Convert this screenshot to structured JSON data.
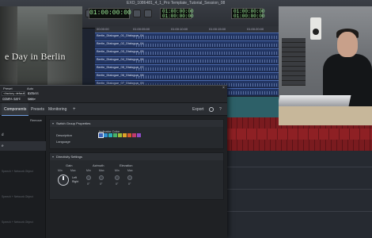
{
  "daw": {
    "window_title": "EXO_1086481_4_1_Pro Template_Tutorial_Session_08",
    "main_counter": "01:00:00:00",
    "sub_counter_a": [
      "01:00:00:00",
      "01:00:00:00",
      "00:00:00:00"
    ],
    "sub_counter_b": [
      "01:00:00:00",
      "01:00:00:00",
      "00:00:00:00"
    ],
    "ruler_marks": [
      "00:00:00",
      "01:00:05:00",
      "01:00:10:00",
      "01:00:15:00",
      "01:00:20:00"
    ],
    "clips": [
      "Berlin_Dialogue_01_Dialogue_04",
      "Berlin_Dialogue_02_Dialogue_04",
      "Berlin_Dialogue_03_Dialogue_05",
      "Berlin_Dialogue_04_Dialogue_06",
      "Berlin_Dialogue_05_Dialogue_07",
      "Berlin_Dialogue_06_Dialogue_08",
      "Berlin_Dialogue_07_Dialogue_09",
      "Berlin_Dialogue_08_Dialogue_10"
    ]
  },
  "video": {
    "caption": "e Day in Berlin"
  },
  "dialog": {
    "preset_label": "Preset",
    "preset_value": "<factory default>",
    "auto_label": "Auto",
    "bypass_label": "BYPASS",
    "compare_label": "COMPARE",
    "safe_label": "SAFE",
    "native_label": "Native",
    "close": "×",
    "tabs": [
      "Components",
      "Presets",
      "Monitoring"
    ],
    "active_tab": "Components",
    "add_tab": "+",
    "export_label": "Export",
    "help": "?",
    "sidebar": {
      "remove_label": "Remove",
      "items": [
        "d",
        "e",
        "Speech + Network Object",
        "Speech + Network Object",
        "Speech + Network Object"
      ]
    },
    "switch_group": {
      "title": "Switch Group Properties",
      "description_label": "Description",
      "language_label": "Language",
      "indicator_label": "Indicator Color",
      "colors": [
        "#3b63b7",
        "#2f8fd1",
        "#2cb0b8",
        "#46b26a",
        "#9cbf3a",
        "#e0a329",
        "#d65a2b",
        "#c23a6d",
        "#8e4bc4"
      ]
    },
    "directivity": {
      "title": "Directivity Settings",
      "gain_label": "Gain",
      "azimuth_label": "Azimuth",
      "elevation_label": "Elevation",
      "min": "Min",
      "max": "Max",
      "knob_values": [
        "0°",
        "0°",
        "0°",
        "0°"
      ],
      "lr_top": "Left",
      "lr_bottom": "Right"
    }
  }
}
